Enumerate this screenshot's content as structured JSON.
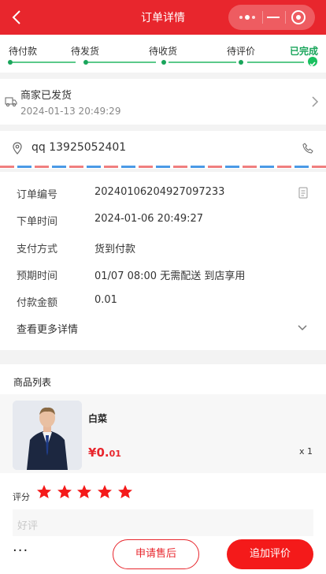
{
  "header": {
    "title": "订单详情",
    "capsule": {
      "more_icon": "dots-icon",
      "minimize_icon": "minus-icon",
      "close_icon": "target-icon"
    }
  },
  "progress": {
    "steps": [
      {
        "label": "待付款",
        "status": "passed"
      },
      {
        "label": "待发货",
        "status": "passed"
      },
      {
        "label": "待收货",
        "status": "passed"
      },
      {
        "label": "待评价",
        "status": "passed"
      },
      {
        "label": "已完成",
        "status": "current"
      }
    ],
    "colors": {
      "active": "#19a55b",
      "line": "#5bc98a"
    }
  },
  "shipping": {
    "status": "商家已发货",
    "time": "2024-01-13 20:49:29"
  },
  "address": {
    "text": "qq 13925052401"
  },
  "order_info": {
    "rows": [
      {
        "label": "订单编号",
        "value": "20240106204927097233"
      },
      {
        "label": "下单时间",
        "value": "2024-01-06 20:49:27"
      },
      {
        "label": "支付方式",
        "value": "货到付款"
      },
      {
        "label": "预期时间",
        "value": "01/07 08:00 无需配送 到店享用"
      },
      {
        "label": "付款金额",
        "value": "0.01"
      }
    ],
    "more_label": "查看更多详情"
  },
  "goods": {
    "section_title": "商品列表",
    "items": [
      {
        "name": "白菜",
        "price_symbol": "¥",
        "price_int": "0.",
        "price_dec": "01",
        "quantity": "x 1"
      }
    ],
    "rating_label": "评分",
    "rating": 5,
    "rating_max": 5,
    "review_placeholder": "好评"
  },
  "bottom_bar": {
    "more": "···",
    "after_sale_label": "申请售后",
    "add_review_label": "追加评价"
  },
  "colors": {
    "brand": "#e8262d",
    "button": "#f41a1a",
    "star": "#f41a1a"
  }
}
